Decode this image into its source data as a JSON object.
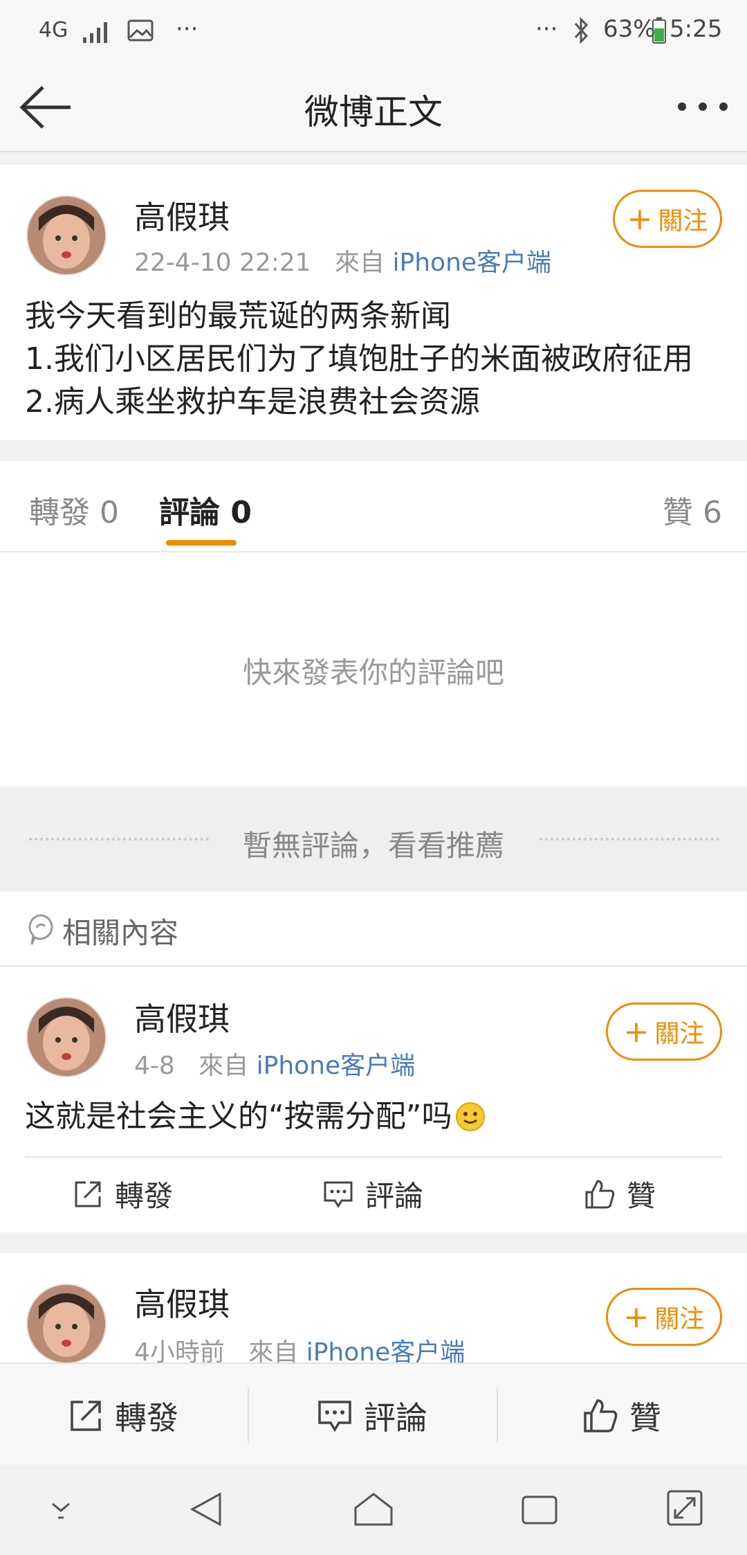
{
  "status_bar": {
    "network": "4G",
    "more_left": "···",
    "more_right": "···",
    "battery": "63%",
    "time": "5:25"
  },
  "nav": {
    "title": "微博正文"
  },
  "post": {
    "author": "高假琪",
    "time": "22-4-10 22:21",
    "from_label": "來自",
    "source": "iPhone客户端",
    "follow_label": "關注",
    "lines": [
      "我今天看到的最荒诞的两条新闻",
      "1.我们小区居民们为了填饱肚子的米面被政府征用",
      "2.病人乘坐救护车是浪费社会资源"
    ]
  },
  "tabs": {
    "repost": "轉發 0",
    "comment": "評論 0",
    "like": "贊 6"
  },
  "empty_comment_text": "快來發表你的評論吧",
  "no_comment_banner": "暫無評論，看看推薦",
  "related": {
    "label": "相關內容"
  },
  "related_posts": [
    {
      "author": "高假琪",
      "time": "4-8",
      "from_label": "來自",
      "source": "iPhone客户端",
      "follow_label": "關注",
      "text": "这就是社会主义的“按需分配”吗",
      "repost": "轉發",
      "comment": "評論",
      "like": "贊"
    },
    {
      "author": "高假琪",
      "time": "4小時前",
      "from_label": "來自",
      "source": "iPhone客户端",
      "follow_label": "關注"
    }
  ],
  "bottom_actions": {
    "repost": "轉發",
    "comment": "評論",
    "like": "贊"
  },
  "colors": {
    "accent": "#f08c00",
    "link": "#4a7bb7"
  }
}
